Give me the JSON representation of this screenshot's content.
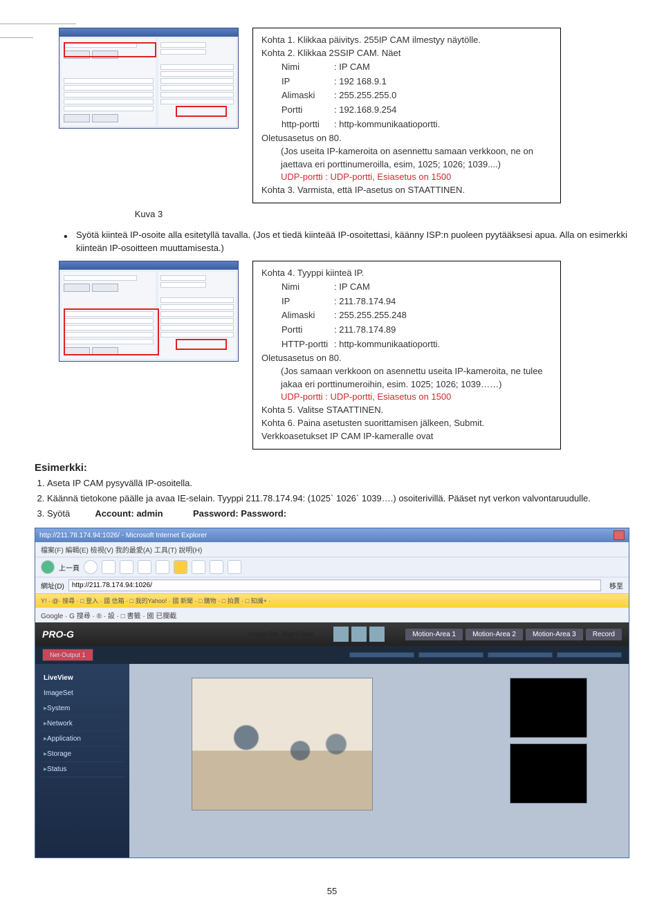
{
  "figure1": {
    "caption": "Kuva 3",
    "info": {
      "kohta1": "Kohta 1. Klikkaa päivitys. 255IP CAM ilmestyy näytölle.",
      "kohta2": "Kohta 2. Klikkaa 2SSIP CAM. Näet",
      "rows": [
        [
          "Nimi",
          ": IP CAM"
        ],
        [
          "IP",
          ": 192 168.9.1"
        ],
        [
          "Alimaski",
          ": 255.255.255.0"
        ],
        [
          "Portti",
          ": 192.168.9.254"
        ],
        [
          "http-portti",
          ": http-kommunikaatioportti."
        ]
      ],
      "oletus": "Oletusasetus on 80.",
      "jos": "(Jos useita IP-kameroita on asennettu samaan verkkoon, ne on jaettava eri porttinumeroilla, esim, 1025; 1026; 1039....)",
      "udp": "UDP-portti : UDP-portti, Esiasetus on 1500",
      "kohta3": "Kohta 3. Varmista, että IP-asetus on STAATTINEN."
    }
  },
  "bullet": "Syötä kiinteä IP-osoite alla esitetyllä tavalla. (Jos et tiedä kiinteää IP-osoitettasi, käänny ISP:n puoleen pyytääksesi apua. Alla on esimerkki kiinteän IP-osoitteen muuttamisesta.)",
  "figure2": {
    "info": {
      "kohta4": "Kohta 4. Tyyppi kiinteä IP.",
      "rows": [
        [
          "Nimi",
          ": IP CAM"
        ],
        [
          "IP",
          ": 211.78.174.94"
        ],
        [
          "Alimaski",
          ": 255.255.255.248"
        ],
        [
          "Portti",
          ": 211.78.174.89"
        ],
        [
          "HTTP-portti",
          ": http-kommunikaatioportti."
        ]
      ],
      "oletus": "Oletusasetus on 80.",
      "jos": "(Jos samaan verkkoon on asennettu useita IP-kameroita, ne tulee jakaa eri porttinumeroihin, esim. 1025; 1026; 1039……)",
      "udp": "UDP-portti : UDP-portti, Esiasetus on 1500",
      "kohta5": "Kohta 5. Valitse STAATTINEN.",
      "kohta6": "Kohta 6. Paina asetusten suorittamisen jälkeen, Submit. Verkkoasetukset IP CAM IP-kameralle ovat"
    }
  },
  "example": {
    "heading": "Esimerkki:",
    "step1": "Aseta IP CAM pysyvällä IP-osoitella.",
    "step2": "Käännä tietokone päälle ja avaa IE-selain. Tyyppi 211.78.174.94: (1025` 1026` 1039….) osoiterivillä. Pääset nyt verkon valvontaruudulle.",
    "step3a": "Syötä",
    "step3b": "Account: admin",
    "step3c": "Password: Password:"
  },
  "browser": {
    "title": "http://211.78.174.94:1026/ - Microsoft Internet Explorer",
    "menu": "檔案(F)  編輯(E)  檢視(V)  我的最愛(A)  工具(T)  說明(H)",
    "tool_back": "上一頁",
    "addr_label": "網址(D)",
    "addr_value": "http://211.78.174.94:1026/",
    "go": "移至",
    "yahoo": "Y! ·  @·   搜尋 ·  □ 登入 ·  國 信箱 ·  □ 我的Yahoo! ·  國 新聞 ·  □ 購物 ·  □ 拍賣 ·  □ 知識+ ·",
    "google": "Google ·                              G 搜尋 ·  ® ·  設 ·  □ 書籤 ·  國 已攔截",
    "logo": "PRO-G",
    "pill1": "ImageSet",
    "pill2": "NightView",
    "tabs": [
      "Motion-Area 1",
      "Motion-Area 2",
      "Motion-Area 3",
      "Record"
    ],
    "subbar2": "Net-Output 1",
    "sidebar": {
      "liveview": "LiveView",
      "imageset": "ImageSet",
      "items": [
        "System",
        "Network",
        "Application",
        "Storage",
        "Status"
      ]
    }
  },
  "pagenum": "55"
}
